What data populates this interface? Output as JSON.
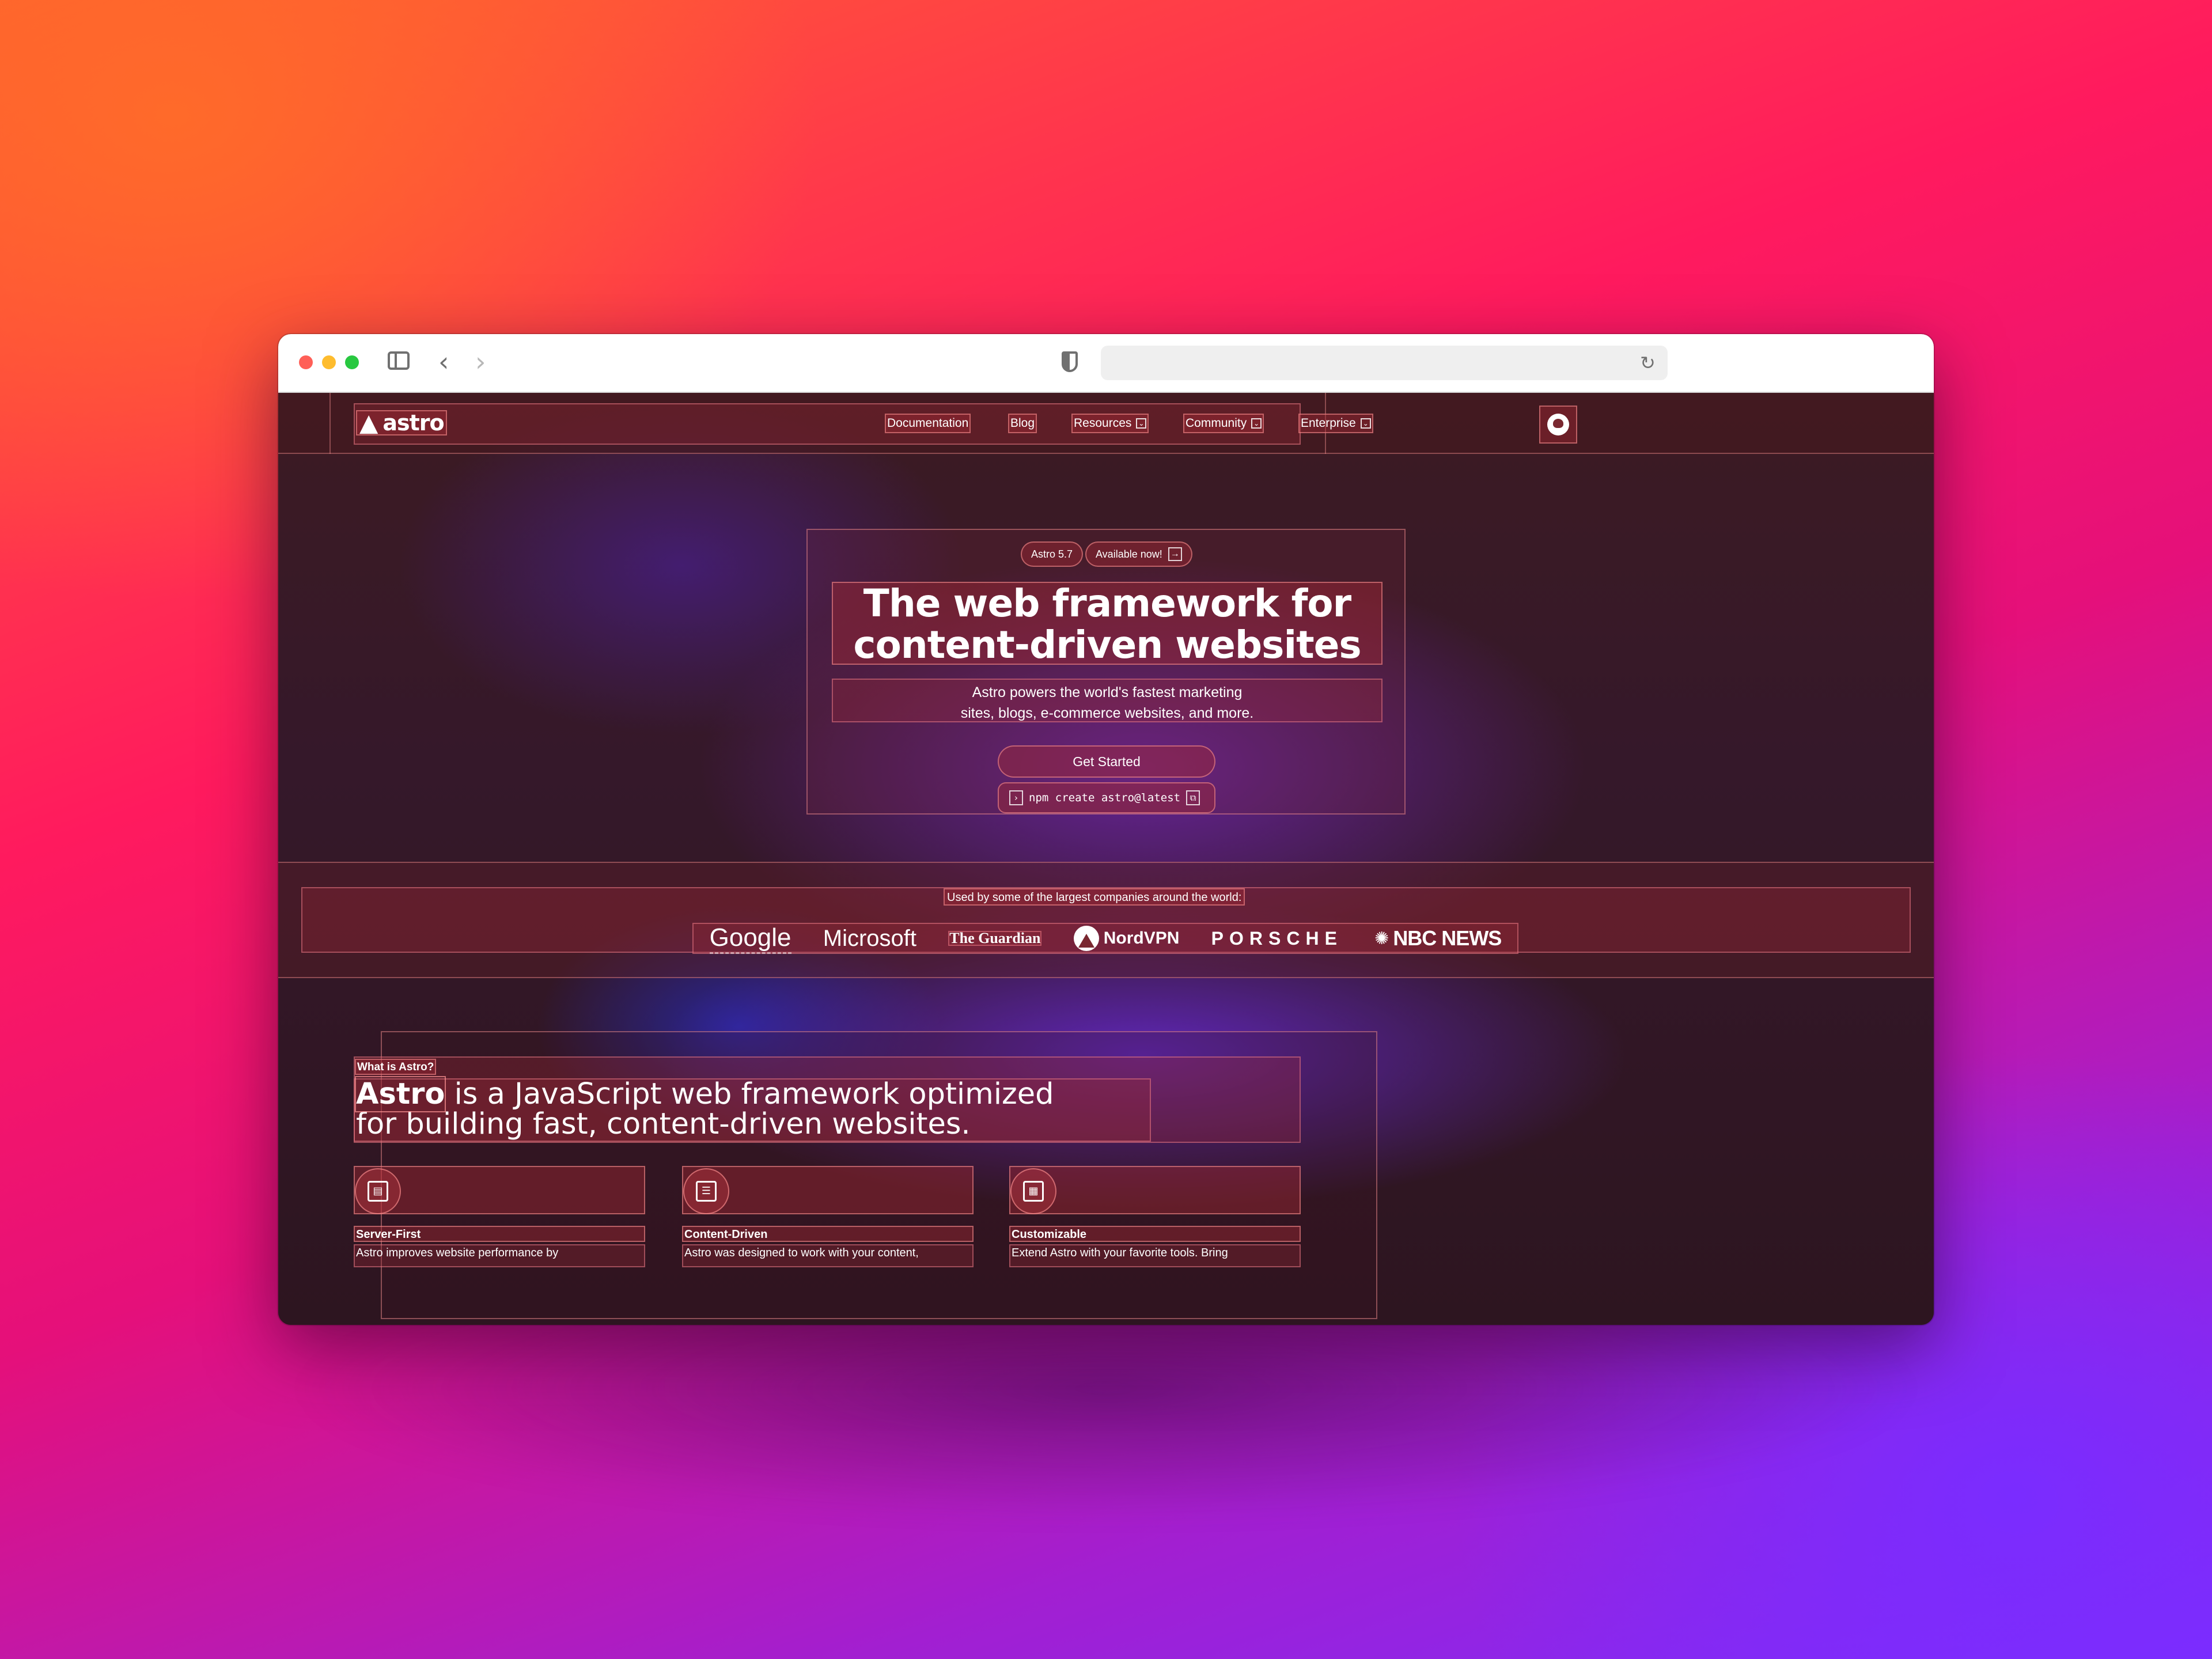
{
  "nav": {
    "logo_text": "astro",
    "items": [
      {
        "label": "Documentation"
      },
      {
        "label": "Blog"
      },
      {
        "label": "Resources"
      },
      {
        "label": "Community"
      },
      {
        "label": "Enterprise"
      }
    ]
  },
  "hero": {
    "version_pill": "Astro 5.7",
    "available_pill": "Available now!",
    "headline_line1": "The web framework for",
    "headline_line2": "content-driven websites",
    "subhead_line1": "Astro powers the world's fastest marketing",
    "subhead_line2": "sites, blogs, e-commerce websites, and more.",
    "cta_label": "Get Started",
    "command": "npm create astro@latest"
  },
  "logos": {
    "caption": "Used by some of the largest companies around the world:",
    "companies": [
      "Google",
      "Microsoft",
      "The Guardian",
      "NordVPN",
      "PORSCHE",
      "NBC NEWS"
    ]
  },
  "what": {
    "label": "What is Astro?",
    "headline_brand": "Astro",
    "headline_line1_rest": " is a JavaScript web framework optimized",
    "headline_line2": "for building fast, content-driven websites."
  },
  "features": [
    {
      "title": "Server-First",
      "text": "Astro improves website performance by",
      "icon": "server-icon"
    },
    {
      "title": "Content-Driven",
      "text": "Astro was designed to work with your content,",
      "icon": "document-icon"
    },
    {
      "title": "Customizable",
      "text": "Extend Astro with your favorite tools. Bring",
      "icon": "grid-icon"
    }
  ],
  "colors": {
    "accent": "#a0283a",
    "outline": "#ff9696",
    "page_bg": "#3a1a1c"
  }
}
